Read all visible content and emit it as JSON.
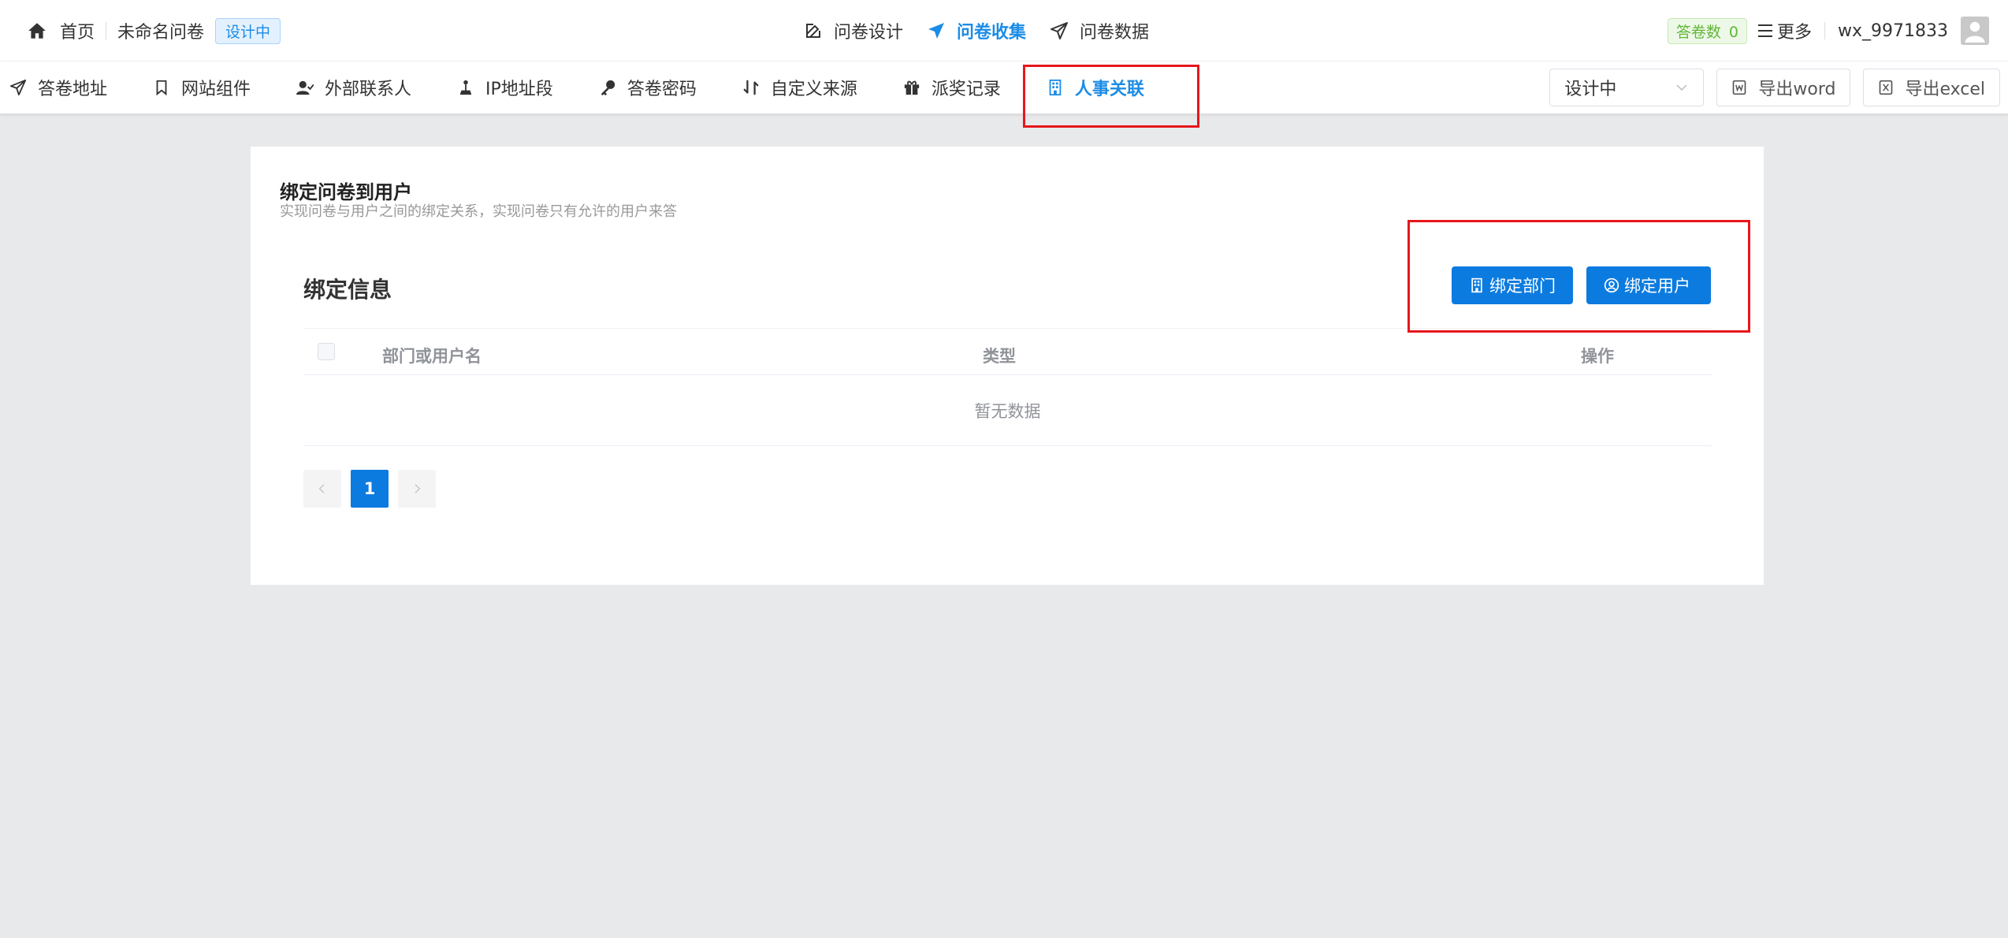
{
  "header": {
    "home_label": "首页",
    "doc_title": "未命名问卷",
    "status_tag": "设计中",
    "tabs": [
      {
        "label": "问卷设计",
        "icon": "edit-icon"
      },
      {
        "label": "问卷收集",
        "icon": "send-icon",
        "active": true
      },
      {
        "label": "问卷数据",
        "icon": "send-outline-icon"
      }
    ],
    "answer_count_label": "答卷数",
    "answer_count": "0",
    "more_label": "更多",
    "user_name": "wx_9971833"
  },
  "toolbar": {
    "tabs": [
      {
        "label": "答卷地址",
        "icon": "send-icon"
      },
      {
        "label": "网站组件",
        "icon": "bookmark-icon"
      },
      {
        "label": "外部联系人",
        "icon": "user-check-icon"
      },
      {
        "label": "IP地址段",
        "icon": "pin-icon"
      },
      {
        "label": "答卷密码",
        "icon": "key-icon"
      },
      {
        "label": "自定义来源",
        "icon": "exchange-icon"
      },
      {
        "label": "派奖记录",
        "icon": "gift-icon"
      },
      {
        "label": "人事关联",
        "icon": "building-icon",
        "active": true
      }
    ],
    "status_select": "设计中",
    "export_word": "导出word",
    "export_excel": "导出excel"
  },
  "main": {
    "title": "绑定问卷到用户",
    "subtitle": "实现问卷与用户之间的绑定关系，实现问卷只有允许的用户来答",
    "section_title": "绑定信息",
    "bind_dept_label": "绑定部门",
    "bind_user_label": "绑定用户",
    "columns": [
      "部门或用户名",
      "类型",
      "操作"
    ],
    "empty_text": "暂无数据",
    "current_page": "1"
  },
  "colors": {
    "accent": "#1c8ce6",
    "primary_button": "#0c7be0",
    "highlight": "#e5171c"
  }
}
